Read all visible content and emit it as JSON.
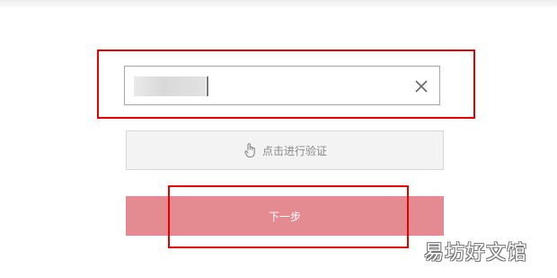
{
  "verify": {
    "label": "点击进行验证"
  },
  "next_button": {
    "label": "下一步"
  },
  "watermark": {
    "text": "易坊好文馆"
  },
  "icons": {
    "clear": "close-icon",
    "verify": "hand-pointer-icon"
  }
}
